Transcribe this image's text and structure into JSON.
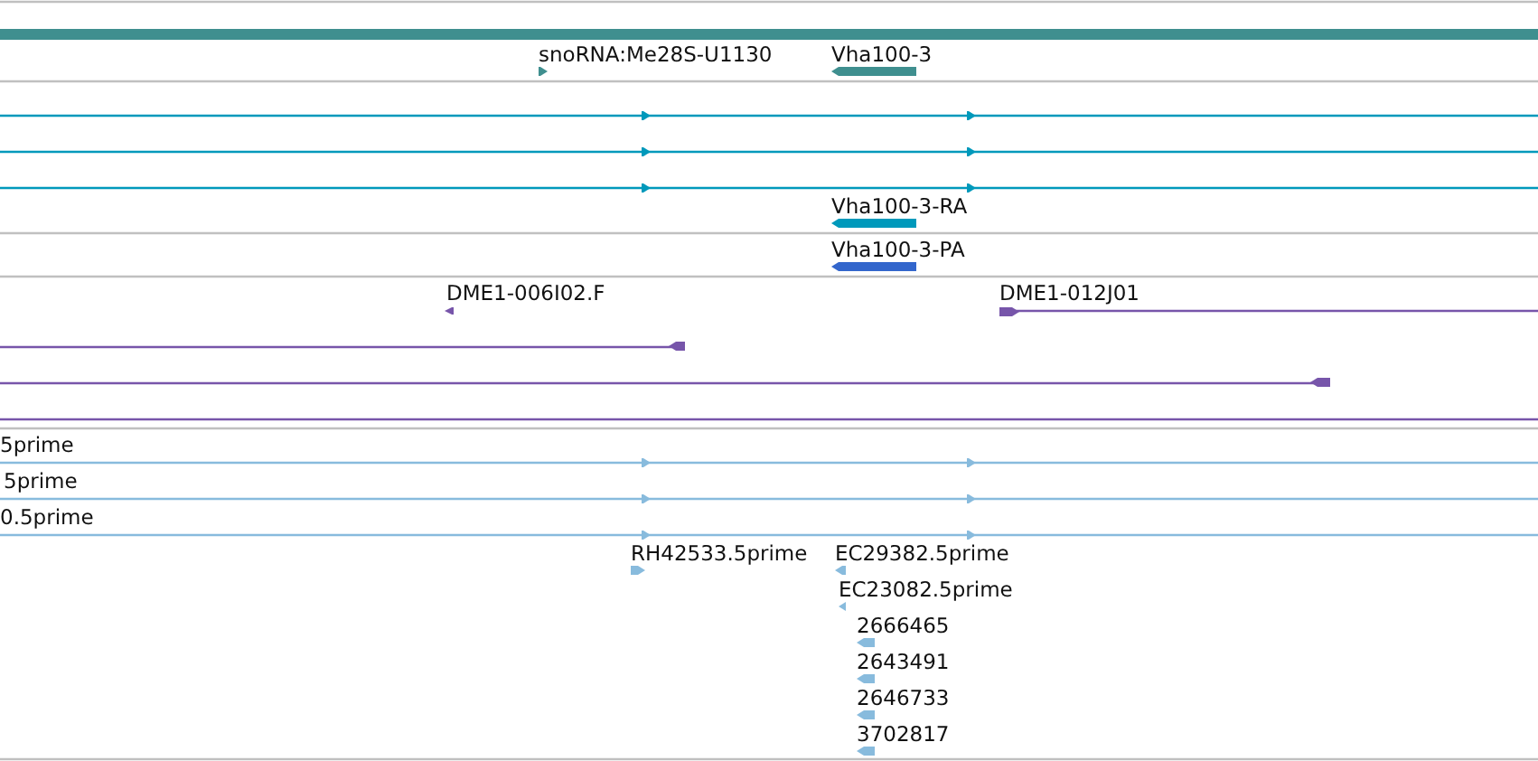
{
  "tracks": [
    {
      "kind": "gene",
      "color": "#3f8f8f",
      "features": [
        {
          "label": "snoRNA:Me28S-U1130",
          "reverse": false
        },
        {
          "label": "Vha100-3",
          "reverse": true
        }
      ]
    },
    {
      "kind": "transcript",
      "color": "#0099bb",
      "features": [
        {
          "reverse": false
        },
        {
          "reverse": false
        },
        {
          "reverse": false
        },
        {
          "label": "Vha100-3-RA",
          "reverse": true
        }
      ]
    },
    {
      "kind": "protein",
      "color": "#3366cc",
      "features": [
        {
          "label": "Vha100-3-PA",
          "reverse": true
        }
      ]
    },
    {
      "kind": "clone",
      "color": "#7755aa",
      "features": [
        {
          "kind": "marker",
          "label": "DME1-006I02.F",
          "reverse": true
        },
        {
          "kind": "span",
          "label": "DME1-012J01",
          "reverse": false
        },
        {
          "kind": "span",
          "reverse": true
        },
        {
          "kind": "span",
          "reverse": true
        },
        {
          "kind": "line"
        }
      ]
    },
    {
      "kind": "est",
      "color": "#88bbdd",
      "features": [
        {
          "label": "5prime",
          "reverse": false
        },
        {
          "label": "5prime",
          "reverse": false
        },
        {
          "label": "0.5prime",
          "reverse": false
        },
        {
          "label": "RH42533.5prime",
          "reverse": false
        },
        {
          "label": "EC29382.5prime",
          "reverse": true
        },
        {
          "label": "EC23082.5prime",
          "reverse": true
        },
        {
          "label": "2666465",
          "reverse": true
        },
        {
          "label": "2643491",
          "reverse": true
        },
        {
          "label": "2646733",
          "reverse": true
        },
        {
          "label": "3702817",
          "reverse": true
        }
      ]
    }
  ]
}
